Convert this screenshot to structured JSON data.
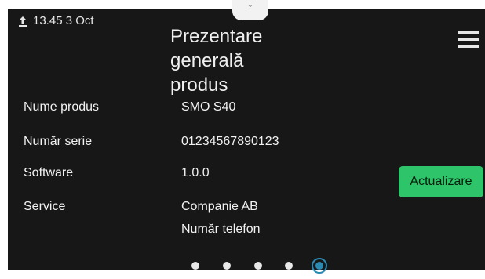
{
  "status": {
    "icon": "upload-icon",
    "time_date": "13.45 3 Oct"
  },
  "page": {
    "title_lines": [
      "Prezentare",
      "generală",
      "produs"
    ],
    "menu_icon": "hamburger-menu-icon"
  },
  "rows": [
    {
      "label": "Nume produs",
      "value": "SMO S40"
    },
    {
      "label": "Număr serie",
      "value": "01234567890123"
    },
    {
      "label": "Software",
      "value": "1.0.0"
    },
    {
      "label": "Service",
      "value": "Companie AB"
    },
    {
      "label": "",
      "value": "Număr telefon"
    }
  ],
  "update_button": {
    "label": "Actualizare"
  },
  "pager": {
    "count": 5,
    "active_index": 4
  },
  "colors": {
    "background": "#171717",
    "accent_green": "#2ec46a",
    "active_dot": "#2a8ab4"
  }
}
